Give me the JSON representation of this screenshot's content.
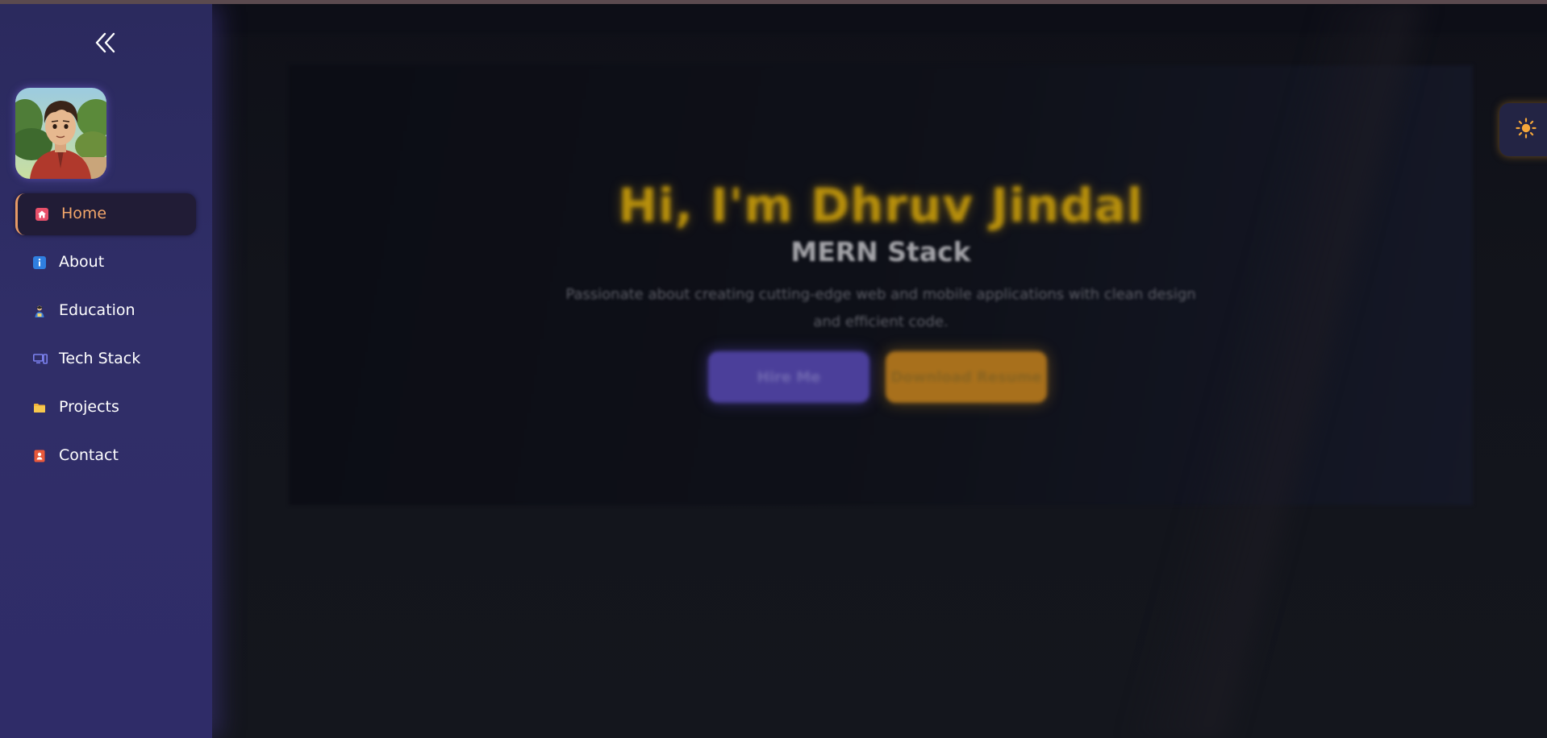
{
  "sidebar": {
    "collapse_icon": "double-chevron-left-icon",
    "avatar_alt": "profile avatar",
    "items": [
      {
        "label": "Home",
        "icon": "home-icon",
        "icon_color": "#e8506a",
        "active": true
      },
      {
        "label": "About",
        "icon": "info-icon",
        "icon_color": "#2f7fe0",
        "active": false
      },
      {
        "label": "Education",
        "icon": "student-icon",
        "icon_color": "#c6a24a",
        "active": false
      },
      {
        "label": "Tech Stack",
        "icon": "computer-icon",
        "icon_color": "#6b70e6",
        "active": false
      },
      {
        "label": "Projects",
        "icon": "folder-icon",
        "icon_color": "#f2b33a",
        "active": false
      },
      {
        "label": "Contact",
        "icon": "contact-card-icon",
        "icon_color": "#e8583a",
        "active": false
      }
    ]
  },
  "hero": {
    "title": "Hi, I'm Dhruv Jindal",
    "subtitle": "MERN Stack",
    "description": "Passionate about creating cutting-edge web and mobile applications with clean design and efficient code.",
    "hire_button": "Hire Me",
    "resume_button": "Download Resume"
  },
  "theme_toggle": {
    "icon": "sun-icon"
  },
  "colors": {
    "accent_orange": "#f2a66a",
    "sidebar_bg": "#2f2c68",
    "title_gold": "#b8900c",
    "hire_purple": "#4b3f9a",
    "resume_amber": "#a8701c"
  }
}
